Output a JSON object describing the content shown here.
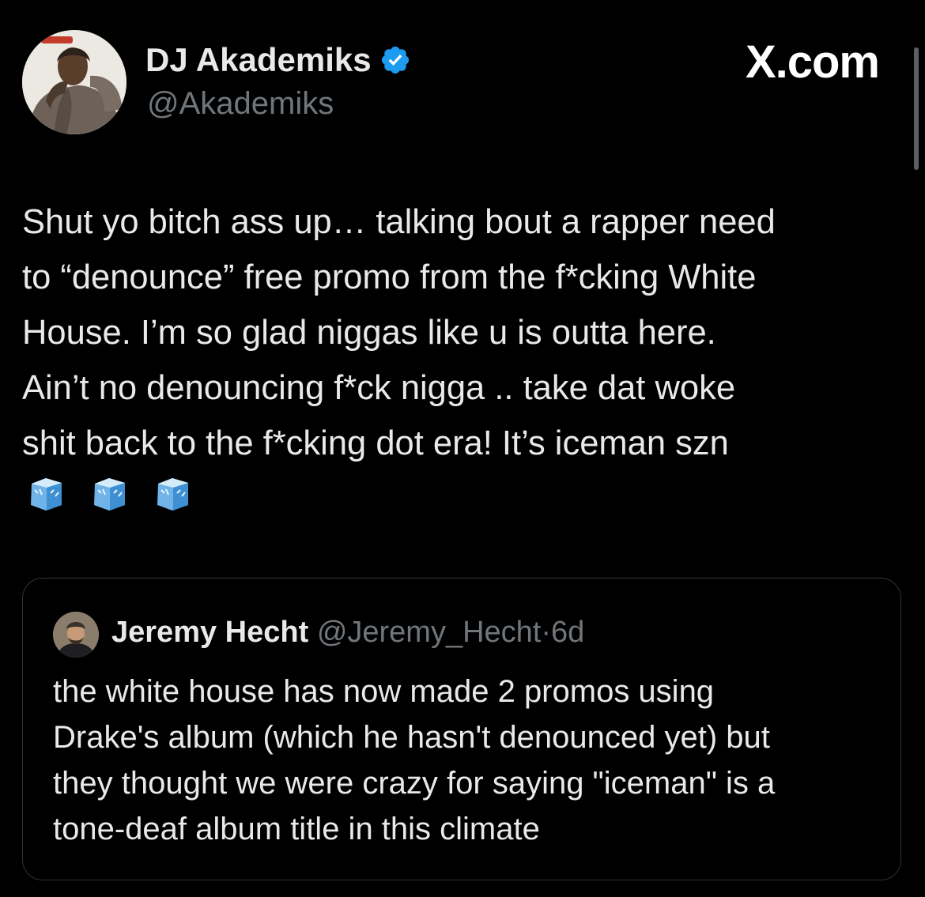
{
  "author": {
    "display_name": "DJ Akademiks",
    "handle": "@Akademiks",
    "verified": true,
    "avatar_icon": "profile-photo"
  },
  "brand": {
    "label": "X.com"
  },
  "tweet": {
    "text": "Shut yo bitch ass up… talking bout a rapper need\nto “denounce” free promo from the f*cking White\nHouse. I’m so glad niggas like u is outta here.\nAin’t no denouncing f*ck nigga .. take dat woke\nshit back to the f*cking dot era! It’s iceman szn",
    "emojis": [
      "ice-cube",
      "ice-cube",
      "ice-cube"
    ]
  },
  "quoted_tweet": {
    "display_name": "Jeremy Hecht",
    "handle": "@Jeremy_Hecht",
    "separator": "·",
    "time": "6d",
    "text": "the white house has now made 2 promos using\nDrake's album (which he hasn't denounced yet) but\nthey thought we were crazy for saying \"iceman\" is a\ntone-deaf album title in this climate"
  },
  "colors": {
    "background": "#000000",
    "text": "#e7e9ea",
    "secondary_text": "#71767b",
    "verified_badge": "#1d9bf0",
    "border": "#2f3336"
  }
}
